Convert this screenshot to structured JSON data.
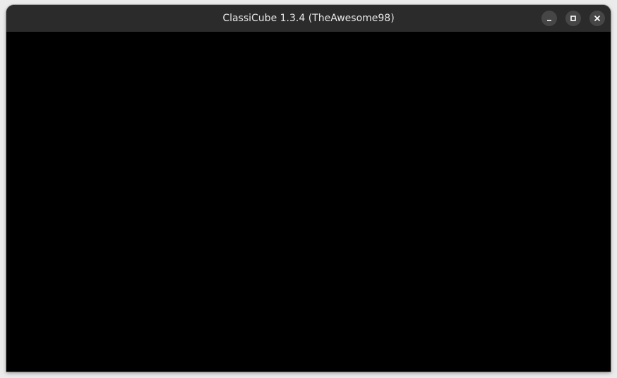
{
  "window": {
    "title": "ClassiCube 1.3.4 (TheAwesome98)",
    "controls": {
      "minimize_icon": "minimize-icon",
      "maximize_icon": "maximize-icon",
      "close_icon": "close-icon"
    }
  },
  "colors": {
    "titlebar": "#2b2b2b",
    "title_text": "#e8e8e8",
    "control_bg": "#464646",
    "content": "#000000"
  }
}
